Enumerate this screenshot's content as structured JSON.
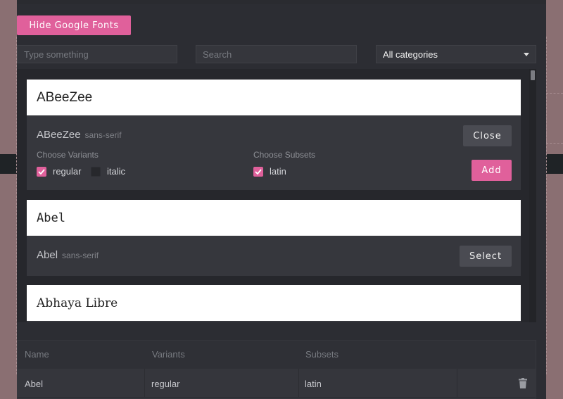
{
  "toolbar": {
    "hide_label": "Hide Google Fonts"
  },
  "filters": {
    "name_placeholder": "Type something",
    "search_placeholder": "Search",
    "category_value": "All categories"
  },
  "fonts": [
    {
      "name": "ABeeZee",
      "category": "sans-serif",
      "expanded": true,
      "button": "Close",
      "variants_label": "Choose Variants",
      "subsets_label": "Choose Subsets",
      "variants": [
        {
          "label": "regular",
          "checked": true
        },
        {
          "label": "italic",
          "checked": false
        }
      ],
      "subsets": [
        {
          "label": "latin",
          "checked": true
        }
      ],
      "add_label": "Add"
    },
    {
      "name": "Abel",
      "category": "sans-serif",
      "expanded": false,
      "button": "Select"
    },
    {
      "name": "Abhaya Libre",
      "expanded": false
    }
  ],
  "selected_table": {
    "headers": [
      "Name",
      "Variants",
      "Subsets"
    ],
    "rows": [
      {
        "name": "Abel",
        "variants": "regular",
        "subsets": "latin"
      }
    ]
  },
  "colors": {
    "accent": "#e0609b",
    "modal_bg": "#2c2d33",
    "card_bg": "#36373d"
  }
}
